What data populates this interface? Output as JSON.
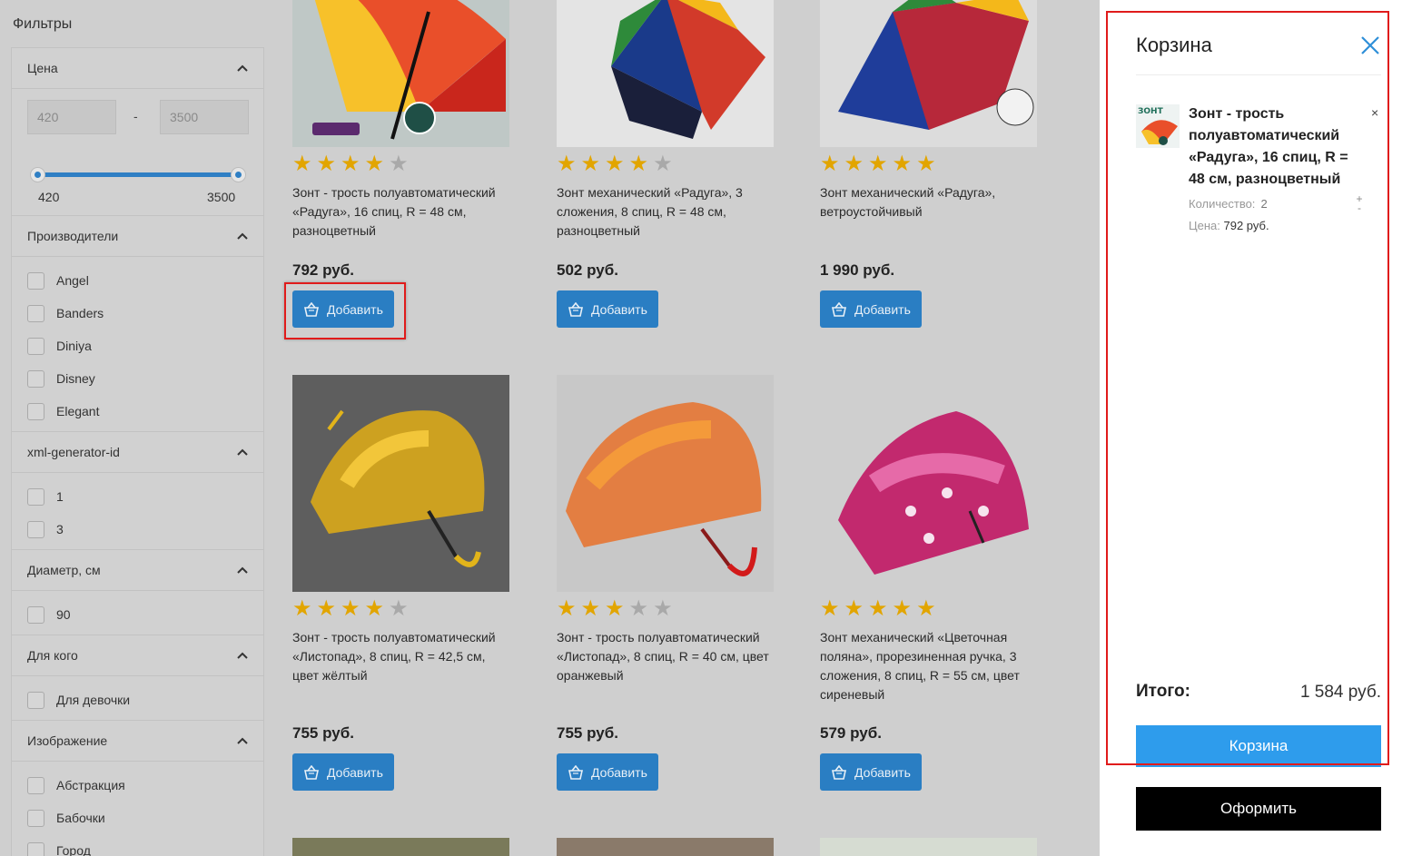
{
  "filters": {
    "title": "Фильтры",
    "price": {
      "label": "Цена",
      "min_value": "420",
      "max_value": "3500",
      "slider_min_label": "420",
      "slider_max_label": "3500"
    },
    "manufacturers": {
      "label": "Производители",
      "options": [
        "Angel",
        "Banders",
        "Diniya",
        "Disney",
        "Elegant"
      ]
    },
    "xml_id": {
      "label": "xml-generator-id",
      "options": [
        "1",
        "3"
      ]
    },
    "diameter": {
      "label": "Диаметр, см",
      "options": [
        "90"
      ]
    },
    "for_whom": {
      "label": "Для кого",
      "options": [
        "Для девочки"
      ]
    },
    "image": {
      "label": "Изображение",
      "options": [
        "Абстракция",
        "Бабочки",
        "Город"
      ]
    }
  },
  "products": [
    {
      "name": "Зонт - трость полуавтоматический «Радуга», 16 спиц, R = 48 см, разноцветный",
      "price": "792 руб.",
      "rating": 4,
      "button": "Добавить"
    },
    {
      "name": "Зонт механический «Радуга», 3 сложения, 8 спиц, R = 48 см, разноцветный",
      "price": "502 руб.",
      "rating": 4,
      "button": "Добавить"
    },
    {
      "name": "Зонт механический «Радуга», ветроустойчивый",
      "price": "1 990 руб.",
      "rating": 5,
      "button": "Добавить"
    },
    {
      "name": "Зонт - трость полуавтоматический «Листопад», 8 спиц, R = 42,5 см, цвет жёлтый",
      "price": "755 руб.",
      "rating": 4,
      "button": "Добавить"
    },
    {
      "name": "Зонт - трость полуавтоматический «Листопад», 8 спиц, R = 40 см, цвет оранжевый",
      "price": "755 руб.",
      "rating": 3,
      "button": "Добавить"
    },
    {
      "name": "Зонт механический «Цветочная поляна», прорезиненная ручка, 3 сложения, 8 спиц, R = 55 см, цвет сиреневый",
      "price": "579 руб.",
      "rating": 5,
      "button": "Добавить"
    }
  ],
  "cart": {
    "title": "Корзина",
    "item": {
      "name": "Зонт - трость полуавтоматический «Радуга», 16 спиц, R = 48 см, разноцветный",
      "qty_label": "Количество:",
      "qty": "2",
      "price_label": "Цена:",
      "price": "792 руб.",
      "thumb_text": "ЗОНТ",
      "remove": "×",
      "inc": "+",
      "dec": "-"
    },
    "total_label": "Итого:",
    "total_value": "1 584 руб.",
    "cart_button": "Корзина",
    "checkout_button": "Оформить"
  },
  "colors": {
    "accent": "#2a7ec3",
    "cart_button": "#2e9cec",
    "highlight": "#e01b1b",
    "star": "#e2a500"
  }
}
